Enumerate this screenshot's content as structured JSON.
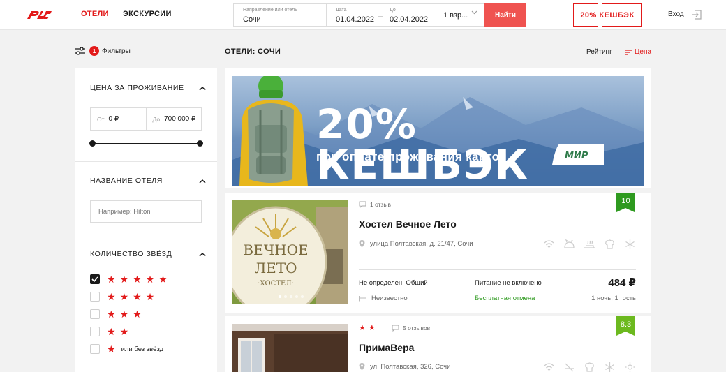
{
  "header": {
    "nav_hotels": "ОТЕЛИ",
    "nav_tours": "ЭКСКУРСИИ",
    "search": {
      "dest_label": "Направление или отель",
      "dest_value": "Сочи",
      "from_label": "Дата",
      "from_value": "01.04.2022",
      "to_label": "До",
      "to_value": "02.04.2022",
      "guests_value": "1 взр...",
      "find_label": "Найти"
    },
    "cashback": "20% КЕШБЭК",
    "login": "Вход"
  },
  "toolbar": {
    "filters_count": "1",
    "filters_label": "Фильтры",
    "title": "ОТЕЛИ: СОЧИ",
    "sort_rating": "Рейтинг",
    "sort_price": "Цена"
  },
  "sidebar": {
    "price_title": "ЦЕНА ЗА ПРОЖИВАНИЕ",
    "price_from_label": "От",
    "price_from_value": "0 ₽",
    "price_to_label": "До",
    "price_to_value": "700 000 ₽",
    "name_title": "НАЗВАНИЕ ОТЕЛЯ",
    "name_placeholder": "Например: Hilton",
    "stars_title": "КОЛИЧЕСТВО ЗВЁЗД",
    "stars_options": [
      {
        "stars": 5,
        "checked": true
      },
      {
        "stars": 4,
        "checked": false
      },
      {
        "stars": 3,
        "checked": false
      },
      {
        "stars": 2,
        "checked": false
      },
      {
        "stars": 1,
        "checked": false,
        "label": "или без звёзд"
      }
    ]
  },
  "banner": {
    "title": "20% КЕШБЭК",
    "subtitle": "при оплате проживания картой",
    "card_brand": "МИР"
  },
  "hotels": [
    {
      "reviews": "1 отзыв",
      "rating": "10",
      "name": "Хостел Вечное Лето",
      "address": "улица Полтавская, д. 21/47, Сочи",
      "sign_line1": "ВЕЧНОЕ",
      "sign_line2": "ЛЕТО",
      "sign_line3": "·ХОСТЕЛ·",
      "room": "Не определен, Общий",
      "meal": "Питание не включено",
      "bed": "Неизвестно",
      "cancel": "Бесплатная отмена",
      "price": "484 ₽",
      "nights": "1 ночь, 1 гость"
    },
    {
      "stars": 2,
      "reviews": "5 отзывов",
      "rating": "8.3",
      "name": "ПримаВера",
      "address": "ул. Полтавская, 326, Сочи"
    }
  ],
  "colors": {
    "accent": "#e21a1a",
    "button": "#ef5350",
    "green": "#2e9a1f"
  }
}
